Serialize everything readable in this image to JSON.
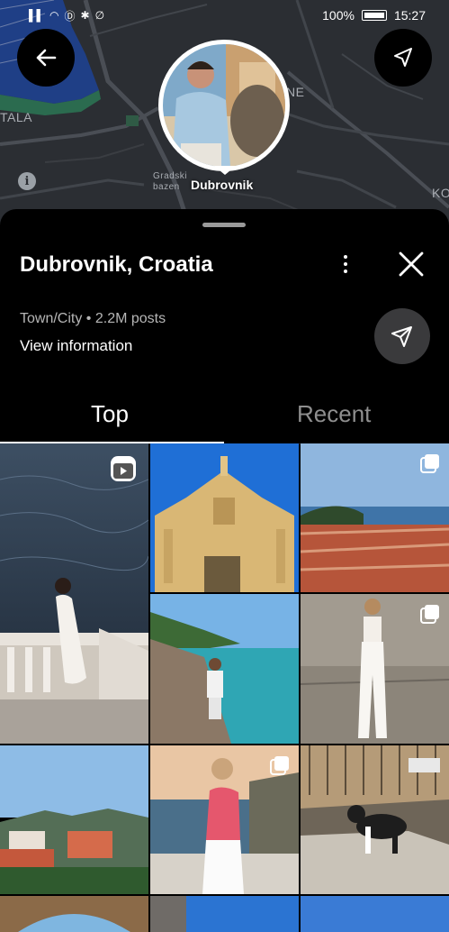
{
  "status_bar": {
    "battery_text": "100%",
    "time": "15:27",
    "left_icons": [
      "signal-icon",
      "wifi-icon",
      "data-icon",
      "bluetooth-icon",
      "mute-icon"
    ]
  },
  "map": {
    "labels": {
      "tala": "TALA",
      "ne": "NE",
      "ko": "KO",
      "gradski_line1": "Gradski",
      "gradski_line2": "bazen"
    },
    "pin_label": "Dubrovnik"
  },
  "place": {
    "title": "Dubrovnik, Croatia",
    "meta": "Town/City • 2.2M posts",
    "view_information": "View information"
  },
  "tabs": [
    {
      "label": "Top"
    },
    {
      "label": "Recent"
    }
  ],
  "grid_posts": [
    {
      "description": "woman in white dress on sea balcony",
      "badge": "reels-icon"
    },
    {
      "description": "baroque church facade against blue sky",
      "badge": ""
    },
    {
      "description": "red rooftops of old town and sea",
      "badge": "carousel-icon"
    },
    {
      "description": "man by turquoise sea on rocks",
      "badge": ""
    },
    {
      "description": "woman in white trousers by stone wall",
      "badge": "carousel-icon"
    },
    {
      "description": "coastal hills and houses",
      "badge": ""
    },
    {
      "description": "woman in pink top at sunset",
      "badge": "carousel-icon"
    },
    {
      "description": "cat on bench by harbor",
      "badge": ""
    }
  ],
  "colors": {
    "accent": "#ffffff",
    "map_bg": "#2b2e33",
    "sheet_bg": "#000000",
    "tab_inactive": "#8e8e8e"
  }
}
